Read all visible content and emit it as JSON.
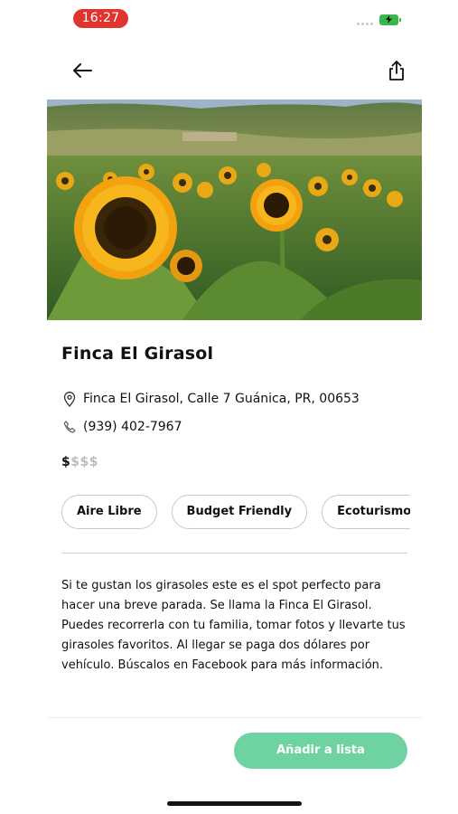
{
  "status_bar": {
    "time": "16:27"
  },
  "header": {
    "back_icon": "arrow-left-icon",
    "share_icon": "share-icon"
  },
  "place": {
    "title": "Finca El Girasol",
    "address": "Finca El Girasol, Calle 7 Guánica, PR, 00653",
    "phone": "(939) 402-7967",
    "price_active": "$",
    "price_inactive": "$$$",
    "description": "Si te gustan los girasoles este es el spot perfecto para hacer una breve parada. Se llama la Finca El Girasol. Puedes recorrerla con tu familia, tomar fotos y llevarte tus girasoles favoritos. Al llegar se paga dos dólares por vehículo. Búscalos en Facebook para más información."
  },
  "tags": [
    "Aire Libre",
    "Budget Friendly",
    "Ecoturismo"
  ],
  "actions": {
    "add_to_list": "Añadir a lista"
  },
  "colors": {
    "accent": "#6fd3a1",
    "status_time_bg": "#e0352f",
    "battery": "#39b54a"
  }
}
